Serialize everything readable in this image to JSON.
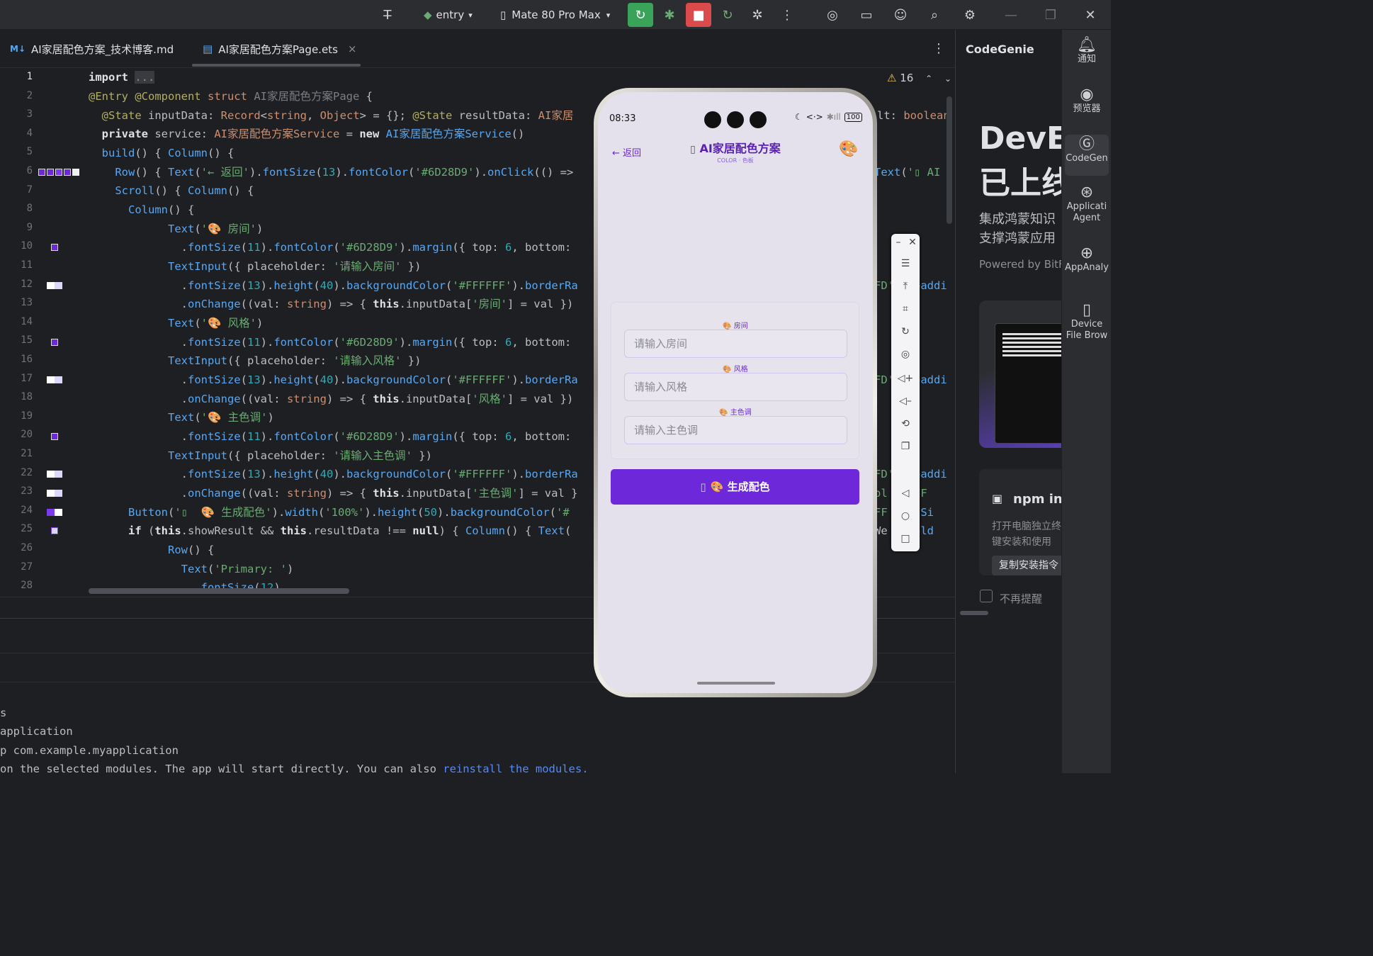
{
  "toolbar": {
    "module": "entry",
    "device": "Mate 80 Pro Max"
  },
  "tabs": [
    {
      "label": "AI家居配色方案_技术博客.md",
      "badge": "M↓"
    },
    {
      "label": "AI家居配色方案Page.ets",
      "close": "×"
    }
  ],
  "editor": {
    "warnings": "16",
    "line_numbers": [
      "1",
      "2",
      "3",
      "4",
      "5",
      "6",
      "7",
      "8",
      "9",
      "10",
      "11",
      "12",
      "13",
      "14",
      "15",
      "16",
      "17",
      "18",
      "19",
      "20",
      "21",
      "22",
      "23",
      "24",
      "25",
      "26",
      "27",
      "28"
    ]
  },
  "run": {
    "lines": [
      "s",
      "application",
      "p com.example.myapplication",
      "on the selected modules. The app will start directly. You can also "
    ],
    "link": "reinstall the modules."
  },
  "codegenie": {
    "title": "CodeGenie",
    "headline1": "DevEc",
    "headline2": "已上线",
    "sub1": "集成鸿蒙知识",
    "sub2": "支撑鸿蒙应用",
    "powered": "Powered by BitFu",
    "npm_title": "npm ins",
    "npm_desc1": "打开电脑独立终",
    "npm_desc2": "键安装和使用",
    "copy_btn": "复制安装指令",
    "no_remind": "不再提醒"
  },
  "rightbar": [
    {
      "label": "通知",
      "icon": "bell-icon"
    },
    {
      "label": "预览器",
      "icon": "eye-icon"
    },
    {
      "label": "CodeGen",
      "icon": "codegenie-icon"
    },
    {
      "label": "Applicati Agent",
      "icon": "agent-icon"
    },
    {
      "label": "AppAnaly",
      "icon": "analyzer-icon"
    },
    {
      "label": "Device File Brow",
      "icon": "device-icon"
    }
  ],
  "phone": {
    "time": "08:33",
    "battery": "100",
    "back": "← 返回",
    "title": "AI家居配色方案",
    "subtitle": "COLOR · 色板",
    "field1_label": "🎨 房间",
    "field1_ph": "请输入房间",
    "field2_label": "🎨 风格",
    "field2_ph": "请输入风格",
    "field3_label": "🎨 主色调",
    "field3_ph": "请输入主色调",
    "button": "🎨 生成配色",
    "accent": "#6D28D9"
  }
}
